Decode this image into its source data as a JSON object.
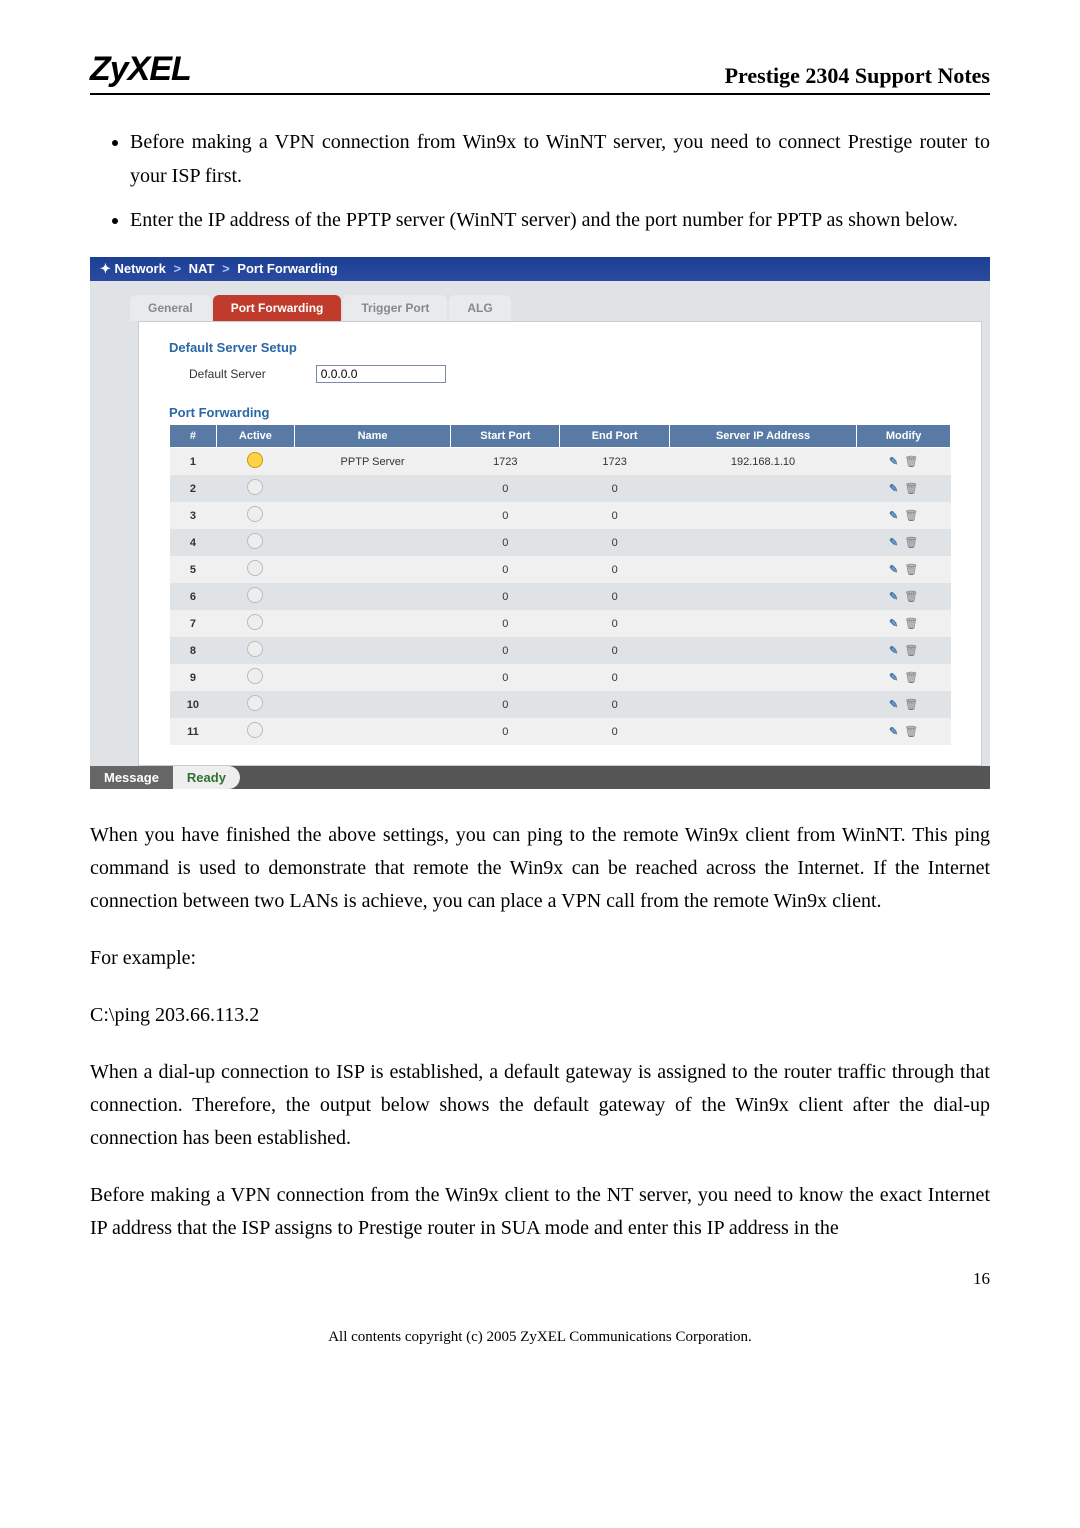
{
  "header": {
    "logo": "ZyXEL",
    "title": "Prestige 2304 Support Notes"
  },
  "bullets": [
    "Before making a VPN connection from Win9x to WinNT server, you need to connect Prestige router to your ISP first.",
    "Enter the IP address of the PPTP server (WinNT server) and the port number for PPTP as shown below."
  ],
  "screenshot": {
    "breadcrumb": {
      "a": "Network",
      "b": "NAT",
      "c": "Port Forwarding"
    },
    "tabs": {
      "general": "General",
      "port_forwarding": "Port Forwarding",
      "trigger_port": "Trigger Port",
      "alg": "ALG"
    },
    "sections": {
      "default_server_setup": "Default Server Setup",
      "default_server_label": "Default Server",
      "default_server_value": "0.0.0.0",
      "port_forwarding": "Port Forwarding"
    },
    "columns": {
      "num": "#",
      "active": "Active",
      "name": "Name",
      "start_port": "Start Port",
      "end_port": "End Port",
      "server_ip": "Server IP Address",
      "modify": "Modify"
    },
    "rows": [
      {
        "n": "1",
        "active": true,
        "name": "PPTP Server",
        "start": "1723",
        "end": "1723",
        "ip": "192.168.1.10"
      },
      {
        "n": "2",
        "active": false,
        "name": "",
        "start": "0",
        "end": "0",
        "ip": ""
      },
      {
        "n": "3",
        "active": false,
        "name": "",
        "start": "0",
        "end": "0",
        "ip": ""
      },
      {
        "n": "4",
        "active": false,
        "name": "",
        "start": "0",
        "end": "0",
        "ip": ""
      },
      {
        "n": "5",
        "active": false,
        "name": "",
        "start": "0",
        "end": "0",
        "ip": ""
      },
      {
        "n": "6",
        "active": false,
        "name": "",
        "start": "0",
        "end": "0",
        "ip": ""
      },
      {
        "n": "7",
        "active": false,
        "name": "",
        "start": "0",
        "end": "0",
        "ip": ""
      },
      {
        "n": "8",
        "active": false,
        "name": "",
        "start": "0",
        "end": "0",
        "ip": ""
      },
      {
        "n": "9",
        "active": false,
        "name": "",
        "start": "0",
        "end": "0",
        "ip": ""
      },
      {
        "n": "10",
        "active": false,
        "name": "",
        "start": "0",
        "end": "0",
        "ip": ""
      },
      {
        "n": "11",
        "active": false,
        "name": "",
        "start": "0",
        "end": "0",
        "ip": ""
      }
    ],
    "message_label": "Message",
    "message_value": "Ready"
  },
  "body": {
    "p1": "When you have finished the above settings, you can ping to the remote Win9x client from WinNT. This ping command is used to demonstrate that remote the Win9x can be reached across the Internet. If the Internet connection between two LANs is achieve, you can place a VPN call from the remote Win9x client.",
    "p2": "For example:",
    "p3": "C:\\ping 203.66.113.2",
    "p4": "When a dial-up connection to ISP is established, a default gateway is assigned to the router traffic through that connection. Therefore, the output below shows the default gateway of the Win9x client after the dial-up connection has been established.",
    "p5": "Before making a VPN connection from the Win9x client to the NT server, you need to know the exact Internet IP address that the ISP assigns to Prestige router in SUA mode and enter this IP address in the"
  },
  "footer": {
    "page": "16",
    "copyright": "All contents copyright (c) 2005 ZyXEL Communications Corporation."
  }
}
